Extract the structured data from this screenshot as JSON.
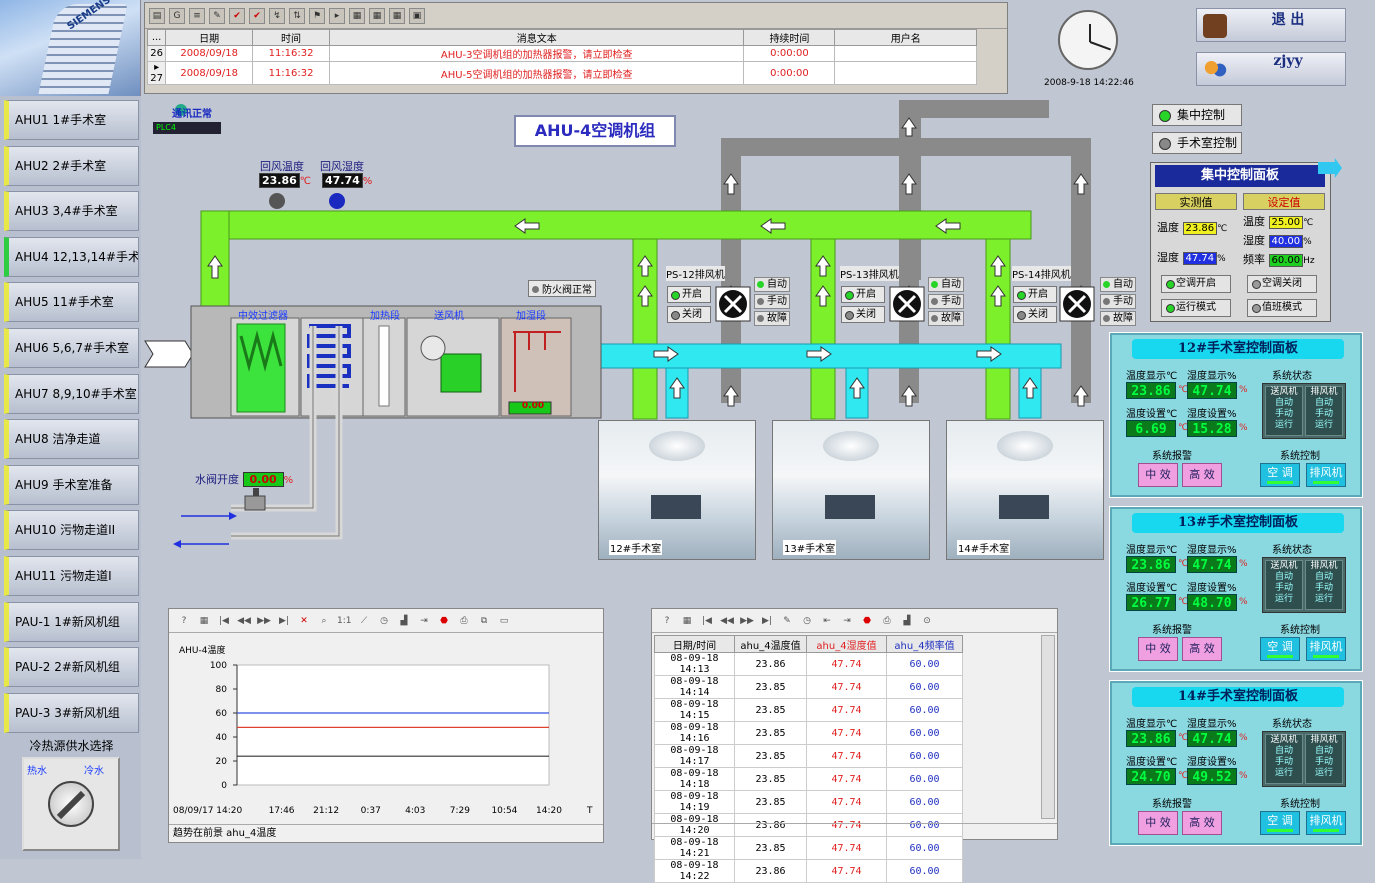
{
  "brand": "SIEMENS",
  "sidebar": {
    "items": [
      {
        "label": "AHU1 1#手术室"
      },
      {
        "label": "AHU2 2#手术室"
      },
      {
        "label": "AHU3 3,4#手术室"
      },
      {
        "label": "AHU4 12,13,14#手术室"
      },
      {
        "label": "AHU5 11#手术室"
      },
      {
        "label": "AHU6 5,6,7#手术室"
      },
      {
        "label": "AHU7 8,9,10#手术室"
      },
      {
        "label": "AHU8 洁净走道"
      },
      {
        "label": "AHU9 手术室准备"
      },
      {
        "label": "AHU10 污物走道II"
      },
      {
        "label": "AHU11 污物走道I"
      },
      {
        "label": "PAU-1 1#新风机组"
      },
      {
        "label": "PAU-2 2#新风机组"
      },
      {
        "label": "PAU-3 3#新风机组"
      }
    ],
    "active_index": 3,
    "valve": {
      "title": "冷热源供水选择",
      "hot": "热水",
      "cold": "冷水"
    }
  },
  "alarm": {
    "columns": [
      "...",
      "日期",
      "时间",
      "消息文本",
      "持续时间",
      "用户名"
    ],
    "rows": [
      {
        "no": "26",
        "date": "2008/09/18",
        "time": "11:16:32",
        "text": "AHU-3空调机组的加热器报警，请立即检查",
        "dur": "0:00:00",
        "user": ""
      },
      {
        "no": "▸ 27",
        "date": "2008/09/18",
        "time": "11:16:32",
        "text": "AHU-5空调机组的加热器报警，请立即检查",
        "dur": "0:00:00",
        "user": ""
      }
    ]
  },
  "clock": {
    "datetime": "2008-9-18 14:22:46"
  },
  "top": {
    "exit_label": "退 出",
    "user_label": "zjyy"
  },
  "diagram": {
    "title": "AHU-4空调机组",
    "comm_status": "通讯正常",
    "plc_label": "PLC4",
    "return_temp_label": "回风温度",
    "return_temp": "23.86",
    "return_temp_unit": "℃",
    "return_hum_label": "回风湿度",
    "return_hum": "47.74",
    "return_hum_unit": "%",
    "sections": [
      "中效过滤器",
      "加热段",
      "送风机",
      "加湿段"
    ],
    "fire_damper": "防火阀正常",
    "humidifier_value": "0.00",
    "water_valve_label": "水阀开度",
    "water_valve": "0.00",
    "water_valve_unit": "%",
    "fans": [
      {
        "name": "PS-12排风机",
        "open": "开启",
        "close": "关闭",
        "auto": "自动",
        "manual": "手动",
        "fault": "故障"
      },
      {
        "name": "PS-13排风机",
        "open": "开启",
        "close": "关闭",
        "auto": "自动",
        "manual": "手动",
        "fault": "故障"
      },
      {
        "name": "PS-14排风机",
        "open": "开启",
        "close": "关闭",
        "auto": "自动",
        "manual": "手动",
        "fault": "故障"
      }
    ],
    "rooms": [
      "12#手术室",
      "13#手术室",
      "14#手术室"
    ]
  },
  "control_mode": {
    "central": "集中控制",
    "room": "手术室控制"
  },
  "central_panel": {
    "title": "集中控制面板",
    "measured": "实测值",
    "setpoint": "设定值",
    "temp_label": "温度",
    "hum_label": "湿度",
    "freq_label": "频率",
    "temp_meas": "23.86",
    "hum_meas": "47.74",
    "temp_set": "25.00",
    "hum_set": "40.00",
    "freq_set": "60.00",
    "u_c": "℃",
    "u_p": "%",
    "u_hz": "Hz",
    "btn_on": "空调开启",
    "btn_off": "空调关闭",
    "btn_run": "运行模式",
    "btn_duty": "值班模式"
  },
  "room_panels": [
    {
      "title": "12#手术室控制面板",
      "temp_disp": "23.86",
      "hum_disp": "47.74",
      "temp_set": "6.69",
      "hum_set": "15.28"
    },
    {
      "title": "13#手术室控制面板",
      "temp_disp": "23.86",
      "hum_disp": "47.74",
      "temp_set": "26.77",
      "hum_set": "48.70"
    },
    {
      "title": "14#手术室控制面板",
      "temp_disp": "23.86",
      "hum_disp": "47.74",
      "temp_set": "24.70",
      "hum_set": "49.52"
    }
  ],
  "room_labels": {
    "temp_disp": "温度显示℃",
    "hum_disp": "湿度显示%",
    "temp_set": "温度设置℃",
    "hum_set": "湿度设置%",
    "sys_status": "系统状态",
    "sys_alarm": "系统报警",
    "sys_ctrl": "系统控制",
    "supply_fan": "送风机",
    "exhaust_fan": "排风机",
    "auto": "自动",
    "manual": "手动",
    "run": "运行",
    "mid_eff": "中 效",
    "high_eff": "高 效",
    "ac": "空 调",
    "exhaust": "排风机",
    "u_c": "℃",
    "u_p": "%"
  },
  "trend": {
    "ylabel": "AHU-4温度",
    "status": "趋势在前景 ahu_4温度",
    "x_labels": [
      "08/09/17  14:20",
      "17:46",
      "21:12",
      "0:37",
      "4:03",
      "7:29",
      "10:54",
      "14:20"
    ],
    "x_last": "T"
  },
  "chart_data": {
    "type": "line",
    "ylabel": "AHU-4温度",
    "ylim": [
      0,
      100
    ],
    "yticks": [
      0,
      20,
      40,
      60,
      80,
      100
    ],
    "categories": [
      "14:20",
      "17:46",
      "21:12",
      "0:37",
      "4:03",
      "7:29",
      "10:54",
      "14:20"
    ],
    "series": [
      {
        "values": [
          60,
          60,
          60,
          60,
          60,
          60,
          60,
          60
        ],
        "color": "#3050e0"
      },
      {
        "values": [
          48,
          48,
          48,
          48,
          48,
          48,
          48,
          48
        ],
        "color": "#e04030"
      },
      {
        "values": [
          24,
          24,
          24,
          24,
          24,
          24,
          24,
          24
        ],
        "color": "#303030"
      }
    ],
    "grid": false
  },
  "table": {
    "headers": [
      "日期/时间",
      "ahu_4温度值",
      "ahu_4湿度值",
      "ahu_4频率值"
    ],
    "rows": [
      [
        "08-09-18 14:13",
        "23.86",
        "47.74",
        "60.00"
      ],
      [
        "08-09-18 14:14",
        "23.85",
        "47.74",
        "60.00"
      ],
      [
        "08-09-18 14:15",
        "23.85",
        "47.74",
        "60.00"
      ],
      [
        "08-09-18 14:16",
        "23.85",
        "47.74",
        "60.00"
      ],
      [
        "08-09-18 14:17",
        "23.85",
        "47.74",
        "60.00"
      ],
      [
        "08-09-18 14:18",
        "23.85",
        "47.74",
        "60.00"
      ],
      [
        "08-09-18 14:19",
        "23.85",
        "47.74",
        "60.00"
      ],
      [
        "08-09-18 14:20",
        "23.86",
        "47.74",
        "60.00"
      ],
      [
        "08-09-18 14:21",
        "23.85",
        "47.74",
        "60.00"
      ],
      [
        "08-09-18 14:22",
        "23.86",
        "47.74",
        "60.00"
      ]
    ]
  }
}
